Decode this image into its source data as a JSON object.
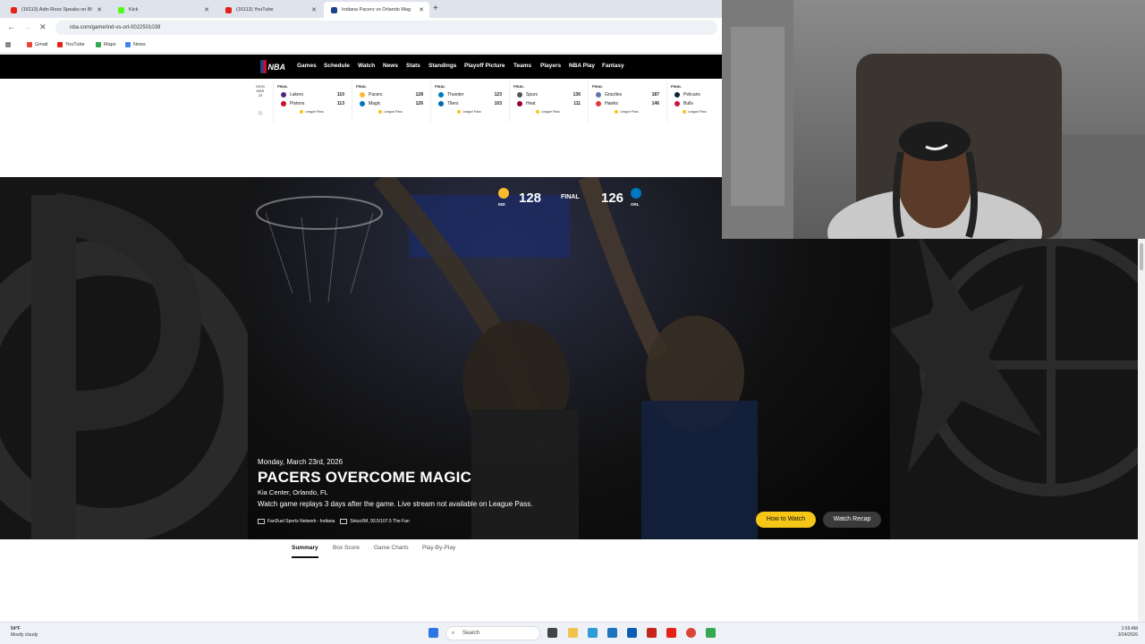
{
  "browser": {
    "tabs": [
      {
        "label": "(16113) Adin Ross Speaks on Bl",
        "favicon_color": "#e62117"
      },
      {
        "label": "Kick",
        "favicon_color": "#53fc18"
      },
      {
        "label": "(16113) YouTube",
        "favicon_color": "#e62117"
      },
      {
        "label": "Indiana Pacers vs Orlando Mag",
        "favicon_color": "#1d428a"
      }
    ],
    "url": "nba.com/game/ind-vs-orl-0022501039",
    "bookmarks": [
      {
        "label": "Gmail",
        "color": "#ea4335"
      },
      {
        "label": "YouTube",
        "color": "#e62117"
      },
      {
        "label": "Maps",
        "color": "#34a853"
      },
      {
        "label": "News",
        "color": "#4285f4"
      }
    ]
  },
  "nba": {
    "logo_text": "NBA",
    "nav": [
      "Games",
      "Schedule",
      "Watch",
      "News",
      "Stats",
      "Standings",
      "Playoff Picture",
      "Teams",
      "Players",
      "NBA Play",
      "Fantasy"
    ],
    "date": {
      "day": "MON",
      "month": "MAR",
      "num": "23"
    },
    "games": [
      {
        "status": "FINAL",
        "t1": "Lakers",
        "s1": "110",
        "c1": "#552583",
        "t2": "Pistons",
        "s2": "113",
        "c2": "#c8102e",
        "lp": "League Pass"
      },
      {
        "status": "FINAL",
        "t1": "Pacers",
        "s1": "128",
        "c1": "#fdbb30",
        "t2": "Magic",
        "s2": "126",
        "c2": "#0077c0",
        "lp": "League Pass"
      },
      {
        "status": "FINAL",
        "t1": "Thunder",
        "s1": "123",
        "c1": "#007ac1",
        "t2": "76ers",
        "s2": "103",
        "c2": "#006bb6",
        "lp": "League Pass"
      },
      {
        "status": "FINAL",
        "t1": "Spurs",
        "s1": "136",
        "c1": "#555555",
        "t2": "Heat",
        "s2": "111",
        "c2": "#98002e",
        "lp": "League Pass"
      },
      {
        "status": "FINAL",
        "t1": "Grizzlies",
        "s1": "187",
        "c1": "#5d76a9",
        "t2": "Hawks",
        "s2": "146",
        "c2": "#e03a3e",
        "lp": "League Pass"
      },
      {
        "status": "FINAL",
        "t1": "Pelicans",
        "s1": "",
        "c1": "#0c2340",
        "t2": "Bulls",
        "s2": "",
        "c2": "#ce1141",
        "lp": "League Pass"
      }
    ],
    "hero": {
      "home_abbr": "IND",
      "home_score": "128",
      "status": "FINAL",
      "away_abbr": "ORL",
      "away_score": "126",
      "date": "Monday, March 23rd, 2026",
      "headline": "PACERS OVERCOME MAGIC",
      "venue": "Kia Center, Orlando, FL",
      "replay_note": "Watch game replays 3 days after the game. Live stream not available on League Pass.",
      "broadcast_tv": "FanDuel Sports Network - Indiana",
      "broadcast_radio": "SiriusXM, 93.5/107.5 The Fan",
      "how_to_watch": "How to Watch",
      "watch_recap": "Watch Recap"
    },
    "subtabs": [
      "Summary",
      "Box Score",
      "Game Charts",
      "Play-By-Play"
    ]
  },
  "taskbar": {
    "weather_temp": "54°F",
    "weather_desc": "Mostly cloudy",
    "search": "Search",
    "time": "1:59 AM",
    "date": "3/24/2026"
  }
}
